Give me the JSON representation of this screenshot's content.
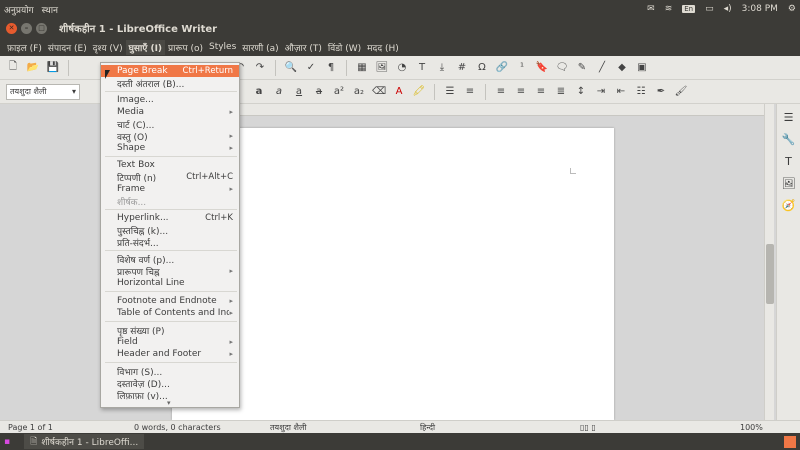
{
  "system_menu": [
    "अनुप्रयोग",
    "स्थान"
  ],
  "tray": {
    "keyboard": "En",
    "time": "3:08 PM"
  },
  "window": {
    "title": "शीर्षकहीन 1 - LibreOffice Writer"
  },
  "menu_bar": [
    "फ़ाइल (F)",
    "संपादन (E)",
    "दृश्य (V)",
    "घुसाएँ (I)",
    "प्रारूप (o)",
    "Styles",
    "सारणी (a)",
    "औज़ार (T)",
    "विंडो (W)",
    "मदद (H)"
  ],
  "style_box": "तयशुदा शैली",
  "insert_menu": {
    "items": [
      {
        "label": "Page Break",
        "shortcut": "Ctrl+Return",
        "state": "highlighted"
      },
      {
        "label": "दस्ती अंतराल (B)...",
        "shortcut": ""
      },
      {
        "label": "Image...",
        "shortcut": ""
      },
      {
        "label": "Media",
        "submenu": true
      },
      {
        "label": "चार्ट (C)...",
        "shortcut": ""
      },
      {
        "label": "वस्तु (O)",
        "submenu": true
      },
      {
        "label": "Shape",
        "submenu": true
      },
      {
        "label": "Text Box",
        "shortcut": ""
      },
      {
        "label": "टिप्पणी (n)",
        "shortcut": "Ctrl+Alt+C"
      },
      {
        "label": "Frame",
        "submenu": true
      },
      {
        "label": "शीर्षक...",
        "state": "disabled"
      },
      {
        "label": "Hyperlink...",
        "shortcut": "Ctrl+K"
      },
      {
        "label": "पुस्तचिह्न (k)...",
        "shortcut": ""
      },
      {
        "label": "प्रति-संदर्भ...",
        "shortcut": ""
      },
      {
        "label": "विशेष वर्ण (p)...",
        "shortcut": ""
      },
      {
        "label": "प्रारूपण चिह्न",
        "submenu": true
      },
      {
        "label": "Horizontal Line",
        "shortcut": ""
      },
      {
        "label": "Footnote and Endnote",
        "submenu": true
      },
      {
        "label": "Table of Contents and Index",
        "submenu": true
      },
      {
        "label": "पृष्ठ संख्या (P)",
        "shortcut": ""
      },
      {
        "label": "Field",
        "submenu": true
      },
      {
        "label": "Header and Footer",
        "submenu": true
      },
      {
        "label": "विभाग (S)...",
        "shortcut": ""
      },
      {
        "label": "दस्तावेज़ (D)...",
        "shortcut": ""
      },
      {
        "label": "लिफ़ाफ़ा (v)...",
        "shortcut": ""
      }
    ]
  },
  "status_bar": {
    "page": "Page 1 of 1",
    "words": "0 words, 0 characters",
    "style": "तयशुदा शैली",
    "language": "हिन्दी",
    "zoom": "100%"
  },
  "taskbar": {
    "task_label": "शीर्षकहीन 1 - LibreOffi..."
  },
  "colors": {
    "accent": "#f07746",
    "panel": "#3c3b37",
    "toolbar": "#e9e8e4"
  }
}
